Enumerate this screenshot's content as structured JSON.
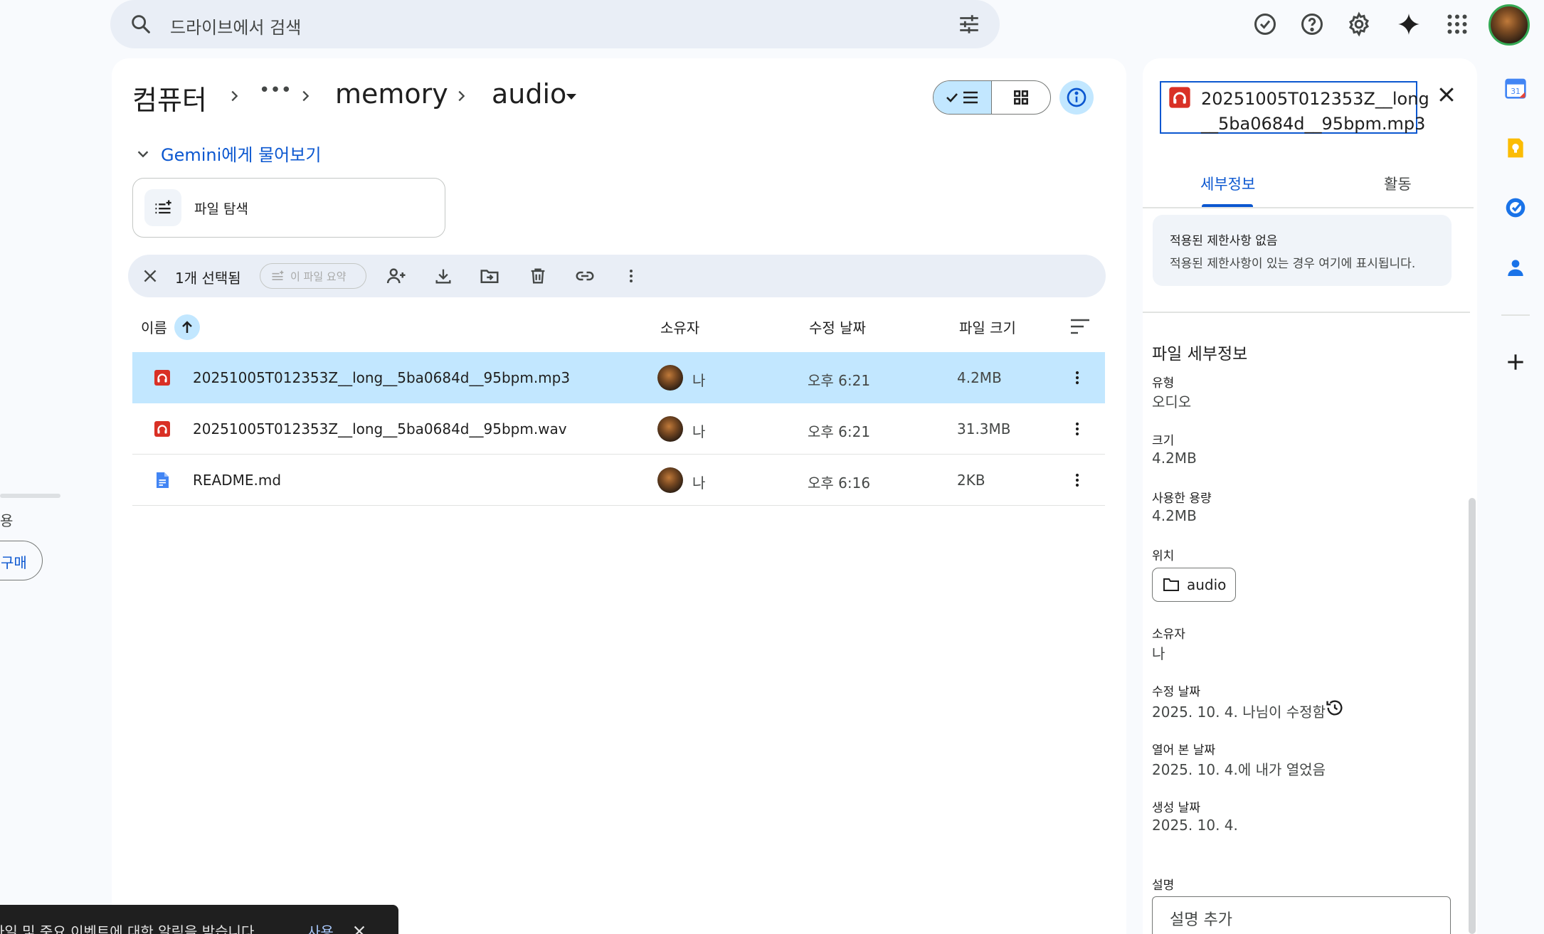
{
  "search": {
    "placeholder": "드라이브에서 검색"
  },
  "breadcrumb": {
    "root": "컴퓨터",
    "ellipsis": "•••",
    "folder": "memory",
    "current": "audio"
  },
  "gemini": {
    "label": "Gemini에게 물어보기"
  },
  "explore": {
    "label": "파일 탐색"
  },
  "selection": {
    "count_label": "1개 선택됨",
    "summarize_label": "이 파일 요약"
  },
  "table": {
    "headers": {
      "name": "이름",
      "owner": "소유자",
      "modified": "수정 날짜",
      "size": "파일 크기"
    },
    "rows": [
      {
        "name": "20251005T012353Z__long__5ba0684d__95bpm.mp3",
        "owner": "나",
        "modified": "오후 6:21",
        "size": "4.2MB",
        "icon": "audio-file-icon",
        "selected": true
      },
      {
        "name": "20251005T012353Z__long__5ba0684d__95bpm.wav",
        "owner": "나",
        "modified": "오후 6:21",
        "size": "31.3MB",
        "icon": "audio-file-icon",
        "selected": false
      },
      {
        "name": "README.md",
        "owner": "나",
        "modified": "오후 6:16",
        "size": "2KB",
        "icon": "doc-file-icon",
        "selected": false
      }
    ]
  },
  "details": {
    "title_line1": "20251005T012353Z__long",
    "title_line2": "__5ba0684d__95bpm.mp3",
    "tabs": {
      "details": "세부정보",
      "activity": "활동"
    },
    "restrictions_title": "적용된 제한사항 없음",
    "restrictions_desc": "적용된 제한사항이 있는 경우 여기에 표시됩니다.",
    "section_title": "파일 세부정보",
    "type_label": "유형",
    "type_value": "오디오",
    "size_label": "크기",
    "size_value": "4.2MB",
    "used_label": "사용한 용량",
    "used_value": "4.2MB",
    "location_label": "위치",
    "location_value": "audio",
    "owner_label": "소유자",
    "owner_value": "나",
    "modified_label": "수정 날짜",
    "modified_value": "2025. 10. 4. 나님이 수정함",
    "opened_label": "열어 본 날짜",
    "opened_value": "2025. 10. 4.에 내가 열었음",
    "created_label": "생성 날짜",
    "created_value": "2025. 10. 4.",
    "description_label": "설명",
    "description_placeholder": "설명 추가"
  },
  "left": {
    "storage_text": "용",
    "button_label": "구매"
  },
  "snackbar": {
    "message": "파일 및 중요 이벤트에 대한 알림을 받습니다.",
    "action": "사용"
  },
  "colors": {
    "accent": "#0b57d0",
    "selected_row": "#c2e7ff",
    "audio_red": "#d93025",
    "doc_blue": "#4285f4"
  }
}
